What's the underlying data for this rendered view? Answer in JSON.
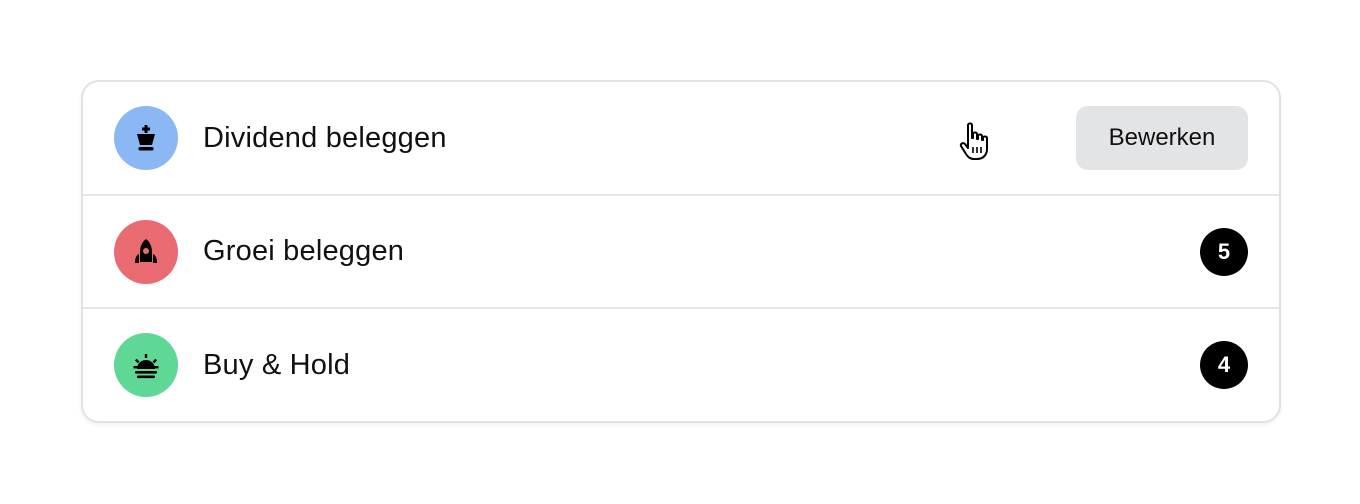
{
  "strategies": [
    {
      "label": "Dividend beleggen",
      "icon": "chess-king-icon",
      "color": "#8bb8f4",
      "action_label": "Bewerken"
    },
    {
      "label": "Groei beleggen",
      "icon": "rocket-icon",
      "color": "#ea6a72",
      "count": "5"
    },
    {
      "label": "Buy & Hold",
      "icon": "sunrise-icon",
      "color": "#5fd896",
      "count": "4"
    }
  ]
}
